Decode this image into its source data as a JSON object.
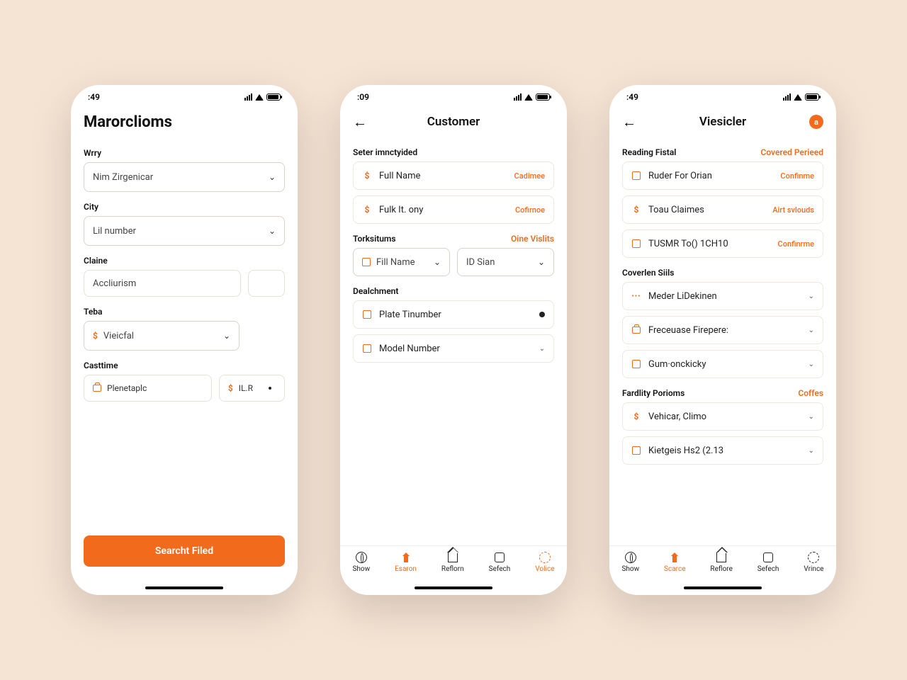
{
  "colors": {
    "accent": "#f26b1d",
    "bg": "#f5e3d3"
  },
  "screen1": {
    "time": ":49",
    "title": "Marorclioms",
    "fields": {
      "wrry": {
        "label": "Wrry",
        "value": "Nim Zirgenicar"
      },
      "city": {
        "label": "City",
        "value": "Lil number"
      },
      "claine": {
        "label": "Claine",
        "value": "Accliurism"
      },
      "teba": {
        "label": "Teba",
        "value": "Vieicfal"
      },
      "casttime": {
        "label": "Casttime",
        "chip1": "Plenetaplc",
        "chip2": "IL.R"
      }
    },
    "cta": "Searcht Filed"
  },
  "screen2": {
    "time": ":09",
    "title": "Customer",
    "section1": {
      "label": "Seter imnctyided",
      "item1": {
        "text": "Full Name",
        "right": "Cadimee"
      },
      "item2": {
        "text": "Fulk It. ony",
        "right": "Cofirnoe"
      }
    },
    "section2": {
      "label": "Torksitums",
      "link": "Oine Vislits",
      "sel1": "Fill Name",
      "sel2": "ID Sian"
    },
    "section3": {
      "label": "Dealchment",
      "item1": "Plate Tinumber",
      "item2": "Model Number"
    },
    "tabs": [
      "Show",
      "Esaron",
      "Reflorn",
      "Sefech",
      "Volice"
    ]
  },
  "screen3": {
    "time": ":49",
    "title": "Viesicler",
    "badge": "a",
    "section1": {
      "label": "Reading Fistal",
      "link": "Covered Perieed",
      "item1": {
        "text": "Ruder For Orian",
        "right": "Confinme"
      },
      "item2": {
        "text": "Toau Claimes",
        "right": "Airt svlouds"
      },
      "item3": {
        "text": "TUSMR To() 1CH10",
        "right": "Confinrme"
      }
    },
    "section2": {
      "label": "Coverlen Siils",
      "item1": "Meder LiDekinen",
      "item2": "Freceuase Firepere:",
      "item3": "Gum·onckicky"
    },
    "section3": {
      "label": "Fardlity Porioms",
      "link": "Coffes",
      "item1": "Vehicar, Climo",
      "item2": "Kietgeis Hs2 (2.13"
    },
    "tabs": [
      "Show",
      "Scarce",
      "Reflore",
      "Sefech",
      "Vrince"
    ]
  }
}
